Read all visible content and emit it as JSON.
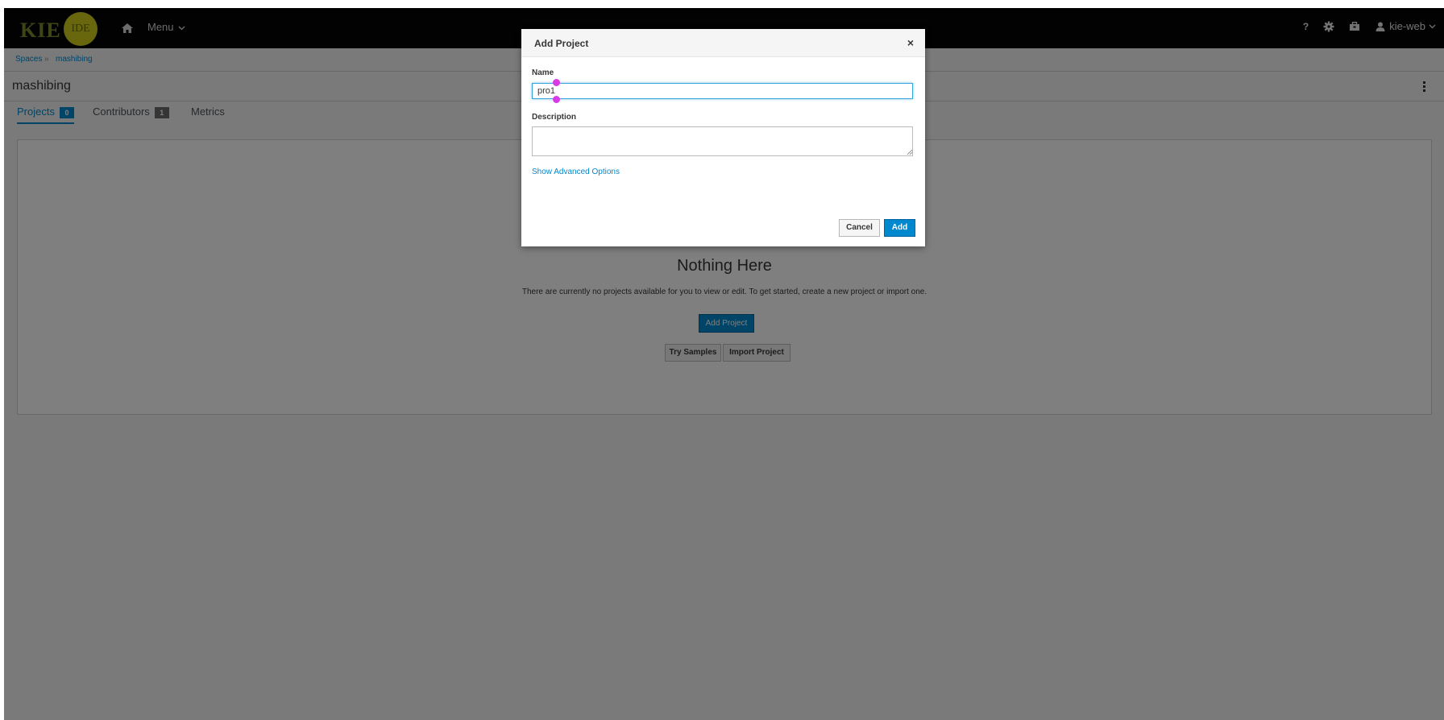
{
  "app": {
    "logo_text": "KIE",
    "logo_badge": "IDE",
    "menu_label": "Menu",
    "user_label": "kie-web",
    "help_label": "?"
  },
  "breadcrumb": {
    "root": "Spaces",
    "separator": "»",
    "current": "mashibing"
  },
  "page": {
    "title": "mashibing"
  },
  "tabs": [
    {
      "label": "Projects",
      "badge": "0"
    },
    {
      "label": "Contributors",
      "badge": "1"
    },
    {
      "label": "Metrics"
    }
  ],
  "empty_state": {
    "title": "Nothing Here",
    "text": "There are currently no projects available for you to view or edit. To get started, create a new project or import one.",
    "add_label": "Add Project",
    "samples_label": "Try Samples",
    "import_label": "Import Project"
  },
  "modal": {
    "title": "Add Project",
    "close_label": "×",
    "name_label": "Name",
    "name_value": "pro1",
    "description_label": "Description",
    "description_value": "",
    "advanced_link": "Show Advanced Options",
    "cancel_label": "Cancel",
    "add_label": "Add"
  },
  "colors": {
    "accent": "#0088ce",
    "topbar": "#050505",
    "selection_handle": "#d63be6"
  },
  "icons": [
    "home-icon",
    "chevron-down-icon",
    "help-icon",
    "gear-icon",
    "briefcase-icon",
    "user-icon",
    "kebab-icon",
    "close-icon"
  ]
}
